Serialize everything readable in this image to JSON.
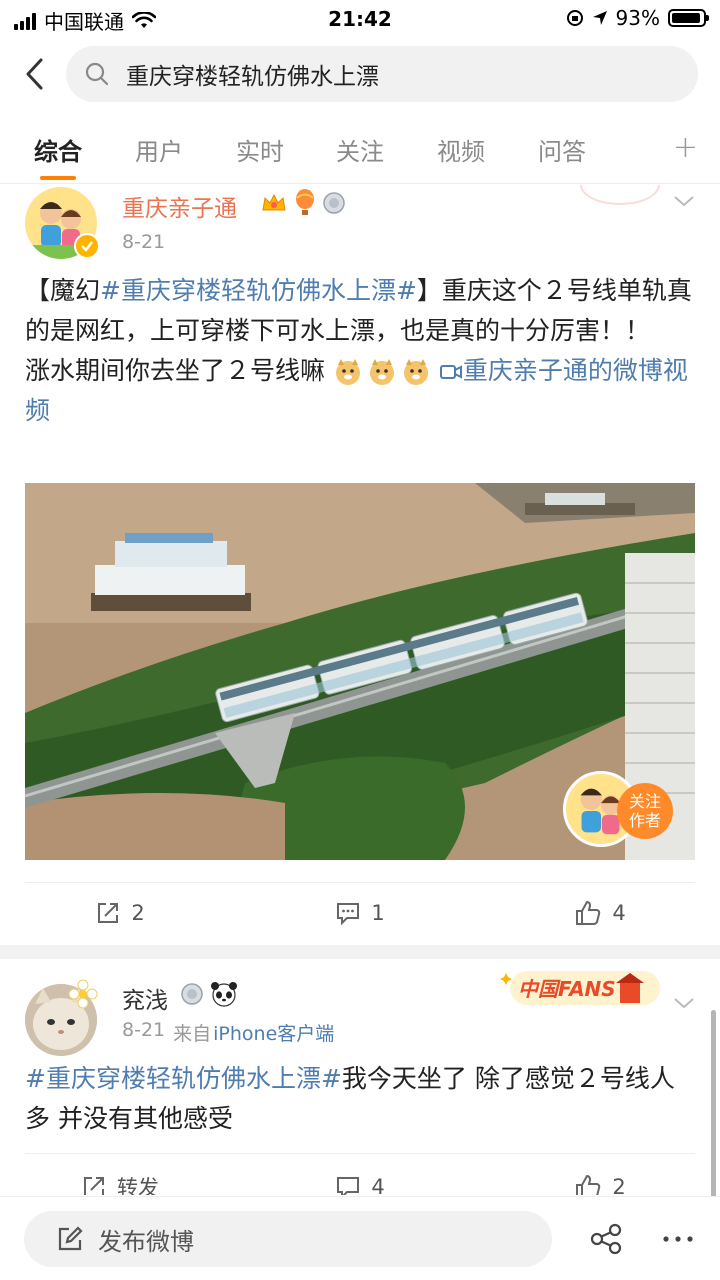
{
  "status": {
    "carrier": "中国联通",
    "time": "21:42",
    "battery_text": "93%",
    "battery_level": 0.93
  },
  "search": {
    "query": "重庆穿楼轻轨仿佛水上漂"
  },
  "tabs": [
    {
      "label": "综合",
      "active": true
    },
    {
      "label": "用户"
    },
    {
      "label": "实时"
    },
    {
      "label": "关注"
    },
    {
      "label": "视频"
    },
    {
      "label": "问答"
    }
  ],
  "tab_more": "+",
  "posts": [
    {
      "username": "重庆亲子通",
      "date": "8-21",
      "text_prefix": "【魔幻",
      "topic": "#重庆穿楼轻轨仿佛水上漂#",
      "text_rest": "】重庆这个２号线单轨真的是网红，上可穿楼下可水上漂，也是真的十分厉害！！",
      "text_line2": "涨水期间你去坐了２号线嘛",
      "link_text": "重庆亲子通的微博视频",
      "follow_badge": "关注作者",
      "actions": {
        "repost": "2",
        "comment": "1",
        "like": "4"
      },
      "accent": "#eb7350"
    },
    {
      "username": "兖浅",
      "date": "8-21",
      "source_prefix": "来自",
      "source": "iPhone客户端",
      "topic": "#重庆穿楼轻轨仿佛水上漂#",
      "text_rest": "我今天坐了 除了感觉２号线人多 并没有其他感受",
      "badge": "中国FANS",
      "actions": {
        "repost": "转发",
        "comment": "4",
        "like": "2"
      }
    }
  ],
  "bottom": {
    "compose_label": "发布微博"
  },
  "colors": {
    "accent": "#ff8200",
    "link": "#507daf",
    "username_orange": "#eb7350"
  }
}
